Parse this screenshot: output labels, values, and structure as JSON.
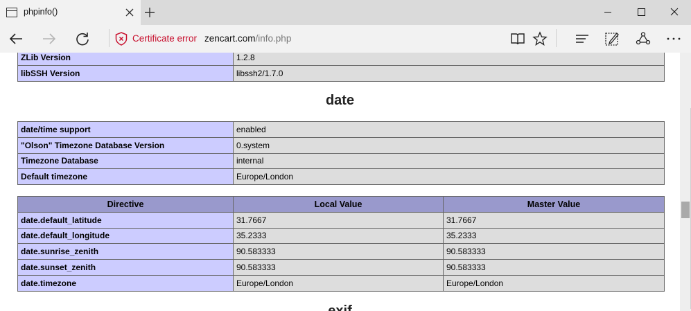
{
  "tab": {
    "title": "phpinfo()"
  },
  "address_bar": {
    "cert_error": "Certificate error",
    "host": "zencart.com",
    "path": "/info.php"
  },
  "icons": [
    "page-icon",
    "close-icon",
    "plus-icon",
    "minimize-icon",
    "maximize-icon",
    "close-icon",
    "back-arrow-icon",
    "forward-arrow-icon",
    "refresh-icon",
    "shield-x-icon",
    "reading-view-icon",
    "star-icon",
    "hub-icon",
    "web-note-icon",
    "share-icon",
    "more-icon"
  ],
  "colors": {
    "row_label_bg": "#ccccff",
    "row_value_bg": "#dddddd",
    "header_bg": "#9999cc",
    "cert_error": "#c8102e"
  },
  "top_rows": [
    {
      "label": "ZLib Version",
      "value": "1.2.8"
    },
    {
      "label": "libSSH Version",
      "value": "libssh2/1.7.0"
    }
  ],
  "date_section": {
    "title": "date",
    "info_rows": [
      {
        "label": "date/time support",
        "value": "enabled"
      },
      {
        "label": "\"Olson\" Timezone Database Version",
        "value": "0.system"
      },
      {
        "label": "Timezone Database",
        "value": "internal"
      },
      {
        "label": "Default timezone",
        "value": "Europe/London"
      }
    ],
    "directive_headers": [
      "Directive",
      "Local Value",
      "Master Value"
    ],
    "directives": [
      {
        "name": "date.default_latitude",
        "local": "31.7667",
        "master": "31.7667"
      },
      {
        "name": "date.default_longitude",
        "local": "35.2333",
        "master": "35.2333"
      },
      {
        "name": "date.sunrise_zenith",
        "local": "90.583333",
        "master": "90.583333"
      },
      {
        "name": "date.sunset_zenith",
        "local": "90.583333",
        "master": "90.583333"
      },
      {
        "name": "date.timezone",
        "local": "Europe/London",
        "master": "Europe/London"
      }
    ]
  },
  "next_section": {
    "title": "exif"
  }
}
